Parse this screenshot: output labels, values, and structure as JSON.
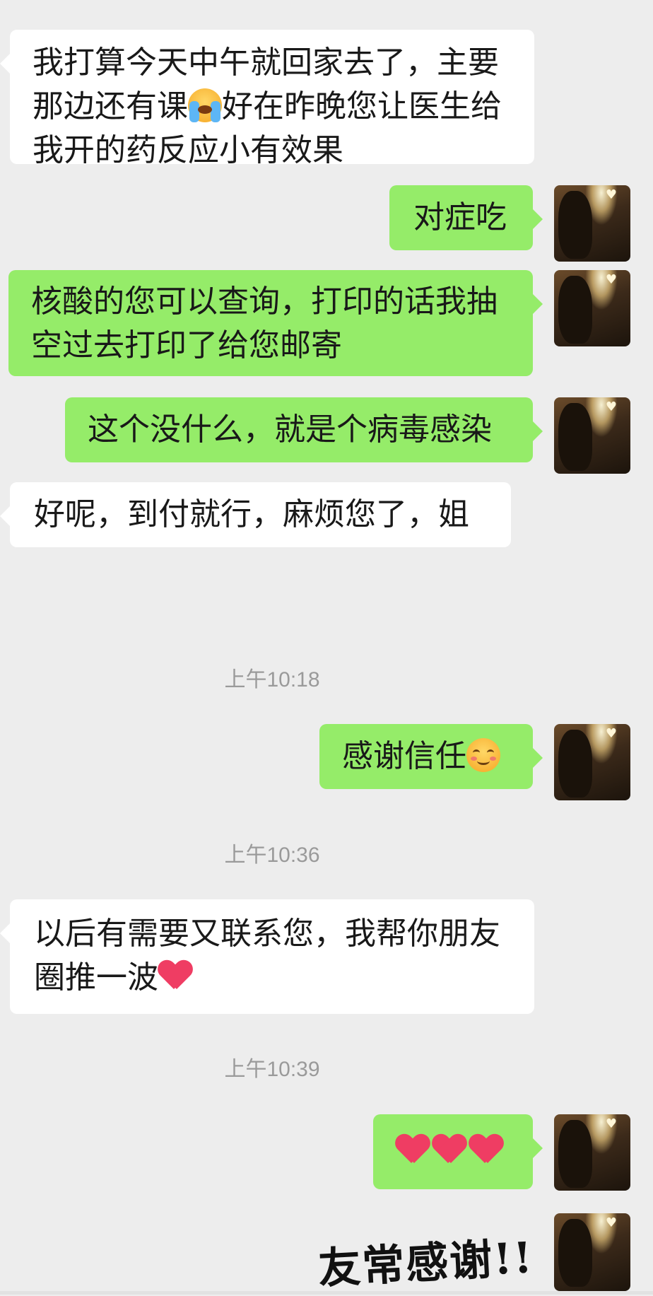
{
  "messages": {
    "m1": {
      "line1": "我打算今天中午就回家去了，主要",
      "line2a": "那边还有课",
      "line2b": "好在昨晚您让医生给",
      "line3": "我开的药反应小有效果"
    },
    "m2": {
      "text": "对症吃"
    },
    "m3": {
      "line1": "核酸的您可以查询，打印的话我抽",
      "line2": "空过去打印了给您邮寄"
    },
    "m4": {
      "text": "这个没什么，就是个病毒感染"
    },
    "m5": {
      "text": "好呢，到付就行，麻烦您了，姐"
    },
    "m6": {
      "text": "感谢信任"
    },
    "m7": {
      "line1": "以后有需要又联系您，我帮你朋友",
      "line2": "圈推一波"
    }
  },
  "timestamps": {
    "t1": "上午10:18",
    "t2": "上午10:36",
    "t3": "上午10:39"
  },
  "handwriting": "友常感谢!!",
  "icons": {
    "avatar": "profile-avatar-girl-heart-sunset",
    "emoji_cry": "loudly-crying-face",
    "emoji_smile": "smiling-face-with-blush",
    "emoji_heart": "red-heart"
  },
  "colors": {
    "background": "#ededed",
    "incoming_bubble": "#ffffff",
    "outgoing_bubble": "#95ec69",
    "timestamp_text": "#9a9a9a"
  }
}
